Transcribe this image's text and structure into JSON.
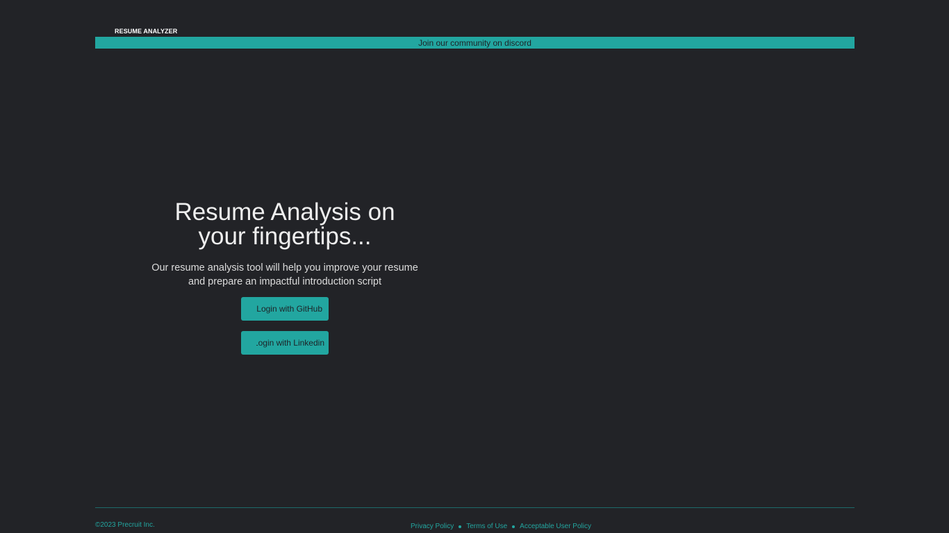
{
  "header": {
    "brand": "RESUME ANALYZER",
    "banner_text": "Join our community on discord"
  },
  "hero": {
    "title_line1": "Resume Analysis on",
    "title_line2": "your fingertips...",
    "subtitle_line1": "Our resume analysis tool will help you improve your resume",
    "subtitle_line2": "and prepare an impactful introduction script"
  },
  "buttons": {
    "github_label": "Login with GitHub",
    "linkedin_label": "Login with Linkedin"
  },
  "footer": {
    "copyright": "©2023 Precruit Inc.",
    "links": [
      "Privacy Policy",
      "Terms of Use",
      "Acceptable User Policy"
    ]
  },
  "colors": {
    "background": "#222327",
    "accent": "#22a6a0",
    "text": "#e6e6e6"
  },
  "icons": {
    "github": "github-icon",
    "linkedin": "linkedin-icon"
  }
}
